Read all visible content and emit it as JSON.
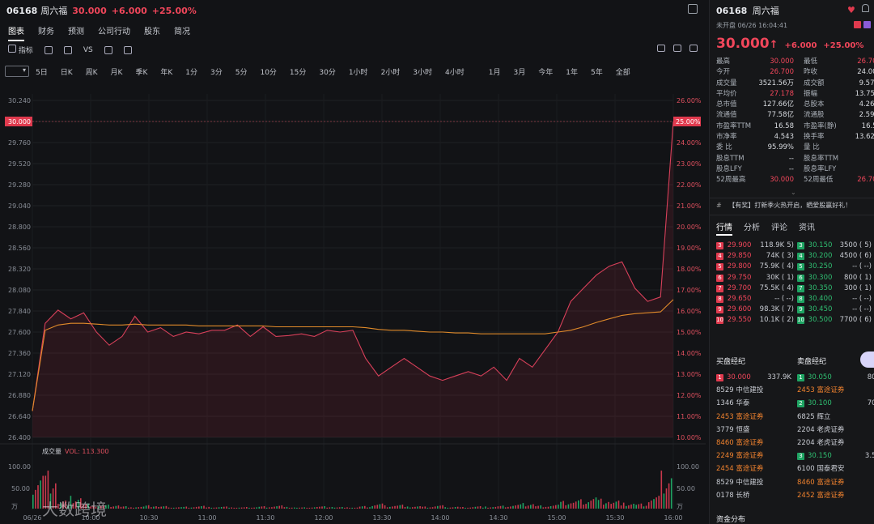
{
  "header": {
    "code": "06168",
    "name": "周六福",
    "price": "30.000",
    "change": "+6.000",
    "change_pct": "+25.00%"
  },
  "tabs": [
    "图表",
    "财务",
    "预测",
    "公司行动",
    "股东",
    "简况"
  ],
  "toolbar": {
    "indicator_label": "指标",
    "vs_label": "VS"
  },
  "periods": [
    "5日",
    "日K",
    "周K",
    "月K",
    "季K",
    "年K",
    "1分",
    "3分",
    "5分",
    "10分",
    "15分",
    "30分",
    "1小时",
    "2小时",
    "3小时",
    "4小时",
    "1月",
    "3月",
    "今年",
    "1年",
    "5年",
    "全部"
  ],
  "chart_data": {
    "type": "line",
    "y_left_ticks": [
      "30.240",
      "30.000",
      "29.760",
      "29.520",
      "29.280",
      "29.040",
      "28.800",
      "28.560",
      "28.320",
      "28.080",
      "27.840",
      "27.600",
      "27.360",
      "27.120",
      "26.880",
      "26.640",
      "26.400"
    ],
    "y_right_ticks": [
      "26.00%",
      "25.00%",
      "24.00%",
      "23.00%",
      "22.00%",
      "21.00%",
      "20.00%",
      "19.00%",
      "18.00%",
      "17.00%",
      "16.00%",
      "15.00%",
      "14.00%",
      "13.00%",
      "12.00%",
      "11.00%",
      "10.00%"
    ],
    "current_price_label": "30.000",
    "current_pct_label": "25.00%",
    "ylim": [
      26.4,
      30.24
    ],
    "x_labels": [
      "06/26",
      "10:00",
      "10:30",
      "11:00",
      "11:30",
      "12:00",
      "13:30",
      "14:00",
      "14:30",
      "15:00",
      "15:30",
      "16:00"
    ],
    "price": [
      26.7,
      27.7,
      27.85,
      27.75,
      27.82,
      27.6,
      27.45,
      27.55,
      27.78,
      27.6,
      27.65,
      27.55,
      27.6,
      27.58,
      27.62,
      27.62,
      27.68,
      27.55,
      27.66,
      27.55,
      27.56,
      27.58,
      27.55,
      27.62,
      27.6,
      27.62,
      27.3,
      27.1,
      27.2,
      27.3,
      27.2,
      27.1,
      27.05,
      27.1,
      27.15,
      27.1,
      27.2,
      27.05,
      27.3,
      27.2,
      27.4,
      27.6,
      27.95,
      28.1,
      28.25,
      28.35,
      28.4,
      28.1,
      27.95,
      28.0,
      30.0
    ],
    "avg_price": [
      26.7,
      27.62,
      27.68,
      27.7,
      27.7,
      27.69,
      27.68,
      27.68,
      27.69,
      27.68,
      27.68,
      27.68,
      27.68,
      27.67,
      27.67,
      27.67,
      27.67,
      27.67,
      27.67,
      27.66,
      27.66,
      27.66,
      27.66,
      27.66,
      27.66,
      27.66,
      27.65,
      27.63,
      27.62,
      27.62,
      27.61,
      27.6,
      27.6,
      27.59,
      27.59,
      27.58,
      27.58,
      27.58,
      27.58,
      27.58,
      27.58,
      27.6,
      27.62,
      27.66,
      27.71,
      27.75,
      27.79,
      27.81,
      27.82,
      27.83,
      27.97
    ],
    "volume_label": "成交量",
    "volume_value": "VOL: 113.300",
    "volume_ticks": [
      "100.00",
      "50.00",
      "万"
    ],
    "volume_right_ticks": [
      "100.00",
      "50.00",
      "万"
    ],
    "volume": [
      88,
      95,
      20,
      30,
      12,
      8,
      10,
      6,
      5,
      8,
      6,
      4,
      5,
      7,
      4,
      5,
      3,
      4,
      6,
      8,
      4,
      3,
      5,
      6,
      4,
      3,
      6,
      12,
      8,
      10,
      6,
      5,
      8,
      5,
      4,
      6,
      5,
      7,
      10,
      14,
      8,
      10,
      18,
      22,
      30,
      25,
      20,
      14,
      12,
      30,
      95
    ]
  },
  "watermark": "大数跨境",
  "right_panel": {
    "code": "06168",
    "name": "周六福",
    "status": "未开盘 06/26 16:04:41",
    "price": "30.000",
    "arrow": "↑",
    "change": "+6.000",
    "change_pct": "+25.00%",
    "stats_left": [
      {
        "label": "最高",
        "value": "30.000",
        "color": "red"
      },
      {
        "label": "今开",
        "value": "26.700",
        "color": "red"
      },
      {
        "label": "成交量",
        "value": "3521.56万",
        "color": ""
      },
      {
        "label": "平均价",
        "value": "27.178",
        "color": "red"
      },
      {
        "label": "总市值",
        "value": "127.66亿",
        "color": ""
      },
      {
        "label": "流通值",
        "value": "77.58亿",
        "color": ""
      },
      {
        "label": "市盈率TTM",
        "value": "16.58",
        "color": ""
      },
      {
        "label": "市净率",
        "value": "4.543",
        "color": ""
      },
      {
        "label": "委 比",
        "value": "95.99%",
        "color": ""
      },
      {
        "label": "股息TTM",
        "value": "--",
        "color": ""
      },
      {
        "label": "股息LFY",
        "value": "--",
        "color": ""
      },
      {
        "label": "52周最高",
        "value": "30.000",
        "color": "red"
      }
    ],
    "stats_right": [
      {
        "label": "最低",
        "value": "26.700",
        "color": "red"
      },
      {
        "label": "昨收",
        "value": "24.000",
        "color": ""
      },
      {
        "label": "成交额",
        "value": "9.57亿",
        "color": ""
      },
      {
        "label": "振幅",
        "value": "13.75%",
        "color": ""
      },
      {
        "label": "总股本",
        "value": "4.26亿",
        "color": ""
      },
      {
        "label": "流通股",
        "value": "2.59亿",
        "color": ""
      },
      {
        "label": "市盈率(静)",
        "value": "16.58",
        "color": ""
      },
      {
        "label": "换手率",
        "value": "13.62%",
        "color": ""
      },
      {
        "label": "量 比",
        "value": "--",
        "color": ""
      },
      {
        "label": "股息率TTM",
        "value": "--",
        "color": ""
      },
      {
        "label": "股息率LFY",
        "value": "--",
        "color": ""
      },
      {
        "label": "52周最低",
        "value": "26.700",
        "color": "red"
      }
    ],
    "promo": "【有奖】打新季火热开启，晒爱股赢好礼！",
    "tabs": [
      "行情",
      "分析",
      "评论",
      "资讯"
    ],
    "bids": [
      {
        "n": "3",
        "price": "29.900",
        "vol": "118.9K (",
        "cnt": "5)"
      },
      {
        "n": "4",
        "price": "29.850",
        "vol": "74K (",
        "cnt": "3)"
      },
      {
        "n": "5",
        "price": "29.800",
        "vol": "75.9K (",
        "cnt": "4)"
      },
      {
        "n": "6",
        "price": "29.750",
        "vol": "30K (",
        "cnt": "1)"
      },
      {
        "n": "7",
        "price": "29.700",
        "vol": "75.5K (",
        "cnt": "4)"
      },
      {
        "n": "8",
        "price": "29.650",
        "vol": "-- (",
        "cnt": "--)"
      },
      {
        "n": "9",
        "price": "29.600",
        "vol": "98.3K (",
        "cnt": "7)"
      },
      {
        "n": "10",
        "price": "29.550",
        "vol": "10.1K (",
        "cnt": "2)"
      }
    ],
    "asks": [
      {
        "n": "3",
        "price": "30.150",
        "vol": "3500 (",
        "cnt": "5)"
      },
      {
        "n": "4",
        "price": "30.200",
        "vol": "4500 (",
        "cnt": "6)"
      },
      {
        "n": "5",
        "price": "30.250",
        "vol": "-- (",
        "cnt": "--)"
      },
      {
        "n": "6",
        "price": "30.300",
        "vol": "800 (",
        "cnt": "1)"
      },
      {
        "n": "7",
        "price": "30.350",
        "vol": "300 (",
        "cnt": "1)"
      },
      {
        "n": "8",
        "price": "30.400",
        "vol": "-- (",
        "cnt": "--)"
      },
      {
        "n": "9",
        "price": "30.450",
        "vol": "-- (",
        "cnt": "--)"
      },
      {
        "n": "10",
        "price": "30.500",
        "vol": "7700 (",
        "cnt": "6)"
      }
    ],
    "bid_broker_title": "买盘经纪",
    "ask_broker_title": "卖盘经纪",
    "bid_brokers": [
      {
        "text": "30.000",
        "extra": "337.9K",
        "badge": "1",
        "color": "red"
      },
      {
        "text": "8529  中信建投",
        "extra": "",
        "badge": "",
        "color": ""
      },
      {
        "text": "1346  华泰",
        "extra": "",
        "badge": "",
        "color": ""
      },
      {
        "text": "2453  富途证券",
        "extra": "",
        "badge": "",
        "color": "orange"
      },
      {
        "text": "3779  恒盛",
        "extra": "",
        "badge": "",
        "color": ""
      },
      {
        "text": "8460  富途证券",
        "extra": "",
        "badge": "",
        "color": "orange"
      },
      {
        "text": "2249  富途证券",
        "extra": "",
        "badge": "",
        "color": "orange"
      },
      {
        "text": "2454  富途证券",
        "extra": "",
        "badge": "",
        "color": "orange"
      },
      {
        "text": "8529  中信建投",
        "extra": "",
        "badge": "",
        "color": ""
      },
      {
        "text": "0178  长桥",
        "extra": "",
        "badge": "",
        "color": ""
      }
    ],
    "ask_brokers": [
      {
        "text": "30.050",
        "extra": "800",
        "badge": "1",
        "color": "green"
      },
      {
        "text": "2453  富途证券",
        "extra": "",
        "badge": "",
        "color": "orange"
      },
      {
        "text": "30.100",
        "extra": "700",
        "badge": "2",
        "color": "green"
      },
      {
        "text": "6825  辉立",
        "extra": "",
        "badge": "",
        "color": ""
      },
      {
        "text": "2204  老虎证券",
        "extra": "",
        "badge": "",
        "color": ""
      },
      {
        "text": "2204  老虎证券",
        "extra": "",
        "badge": "",
        "color": ""
      },
      {
        "text": "30.150",
        "extra": "3.5K",
        "badge": "3",
        "color": "green"
      },
      {
        "text": "6100  国泰君安",
        "extra": "",
        "badge": "",
        "color": ""
      },
      {
        "text": "8460  富途证券",
        "extra": "",
        "badge": "",
        "color": "orange"
      },
      {
        "text": "2452  富途证券",
        "extra": "",
        "badge": "",
        "color": "orange"
      }
    ],
    "capital_title": "资金分布"
  }
}
